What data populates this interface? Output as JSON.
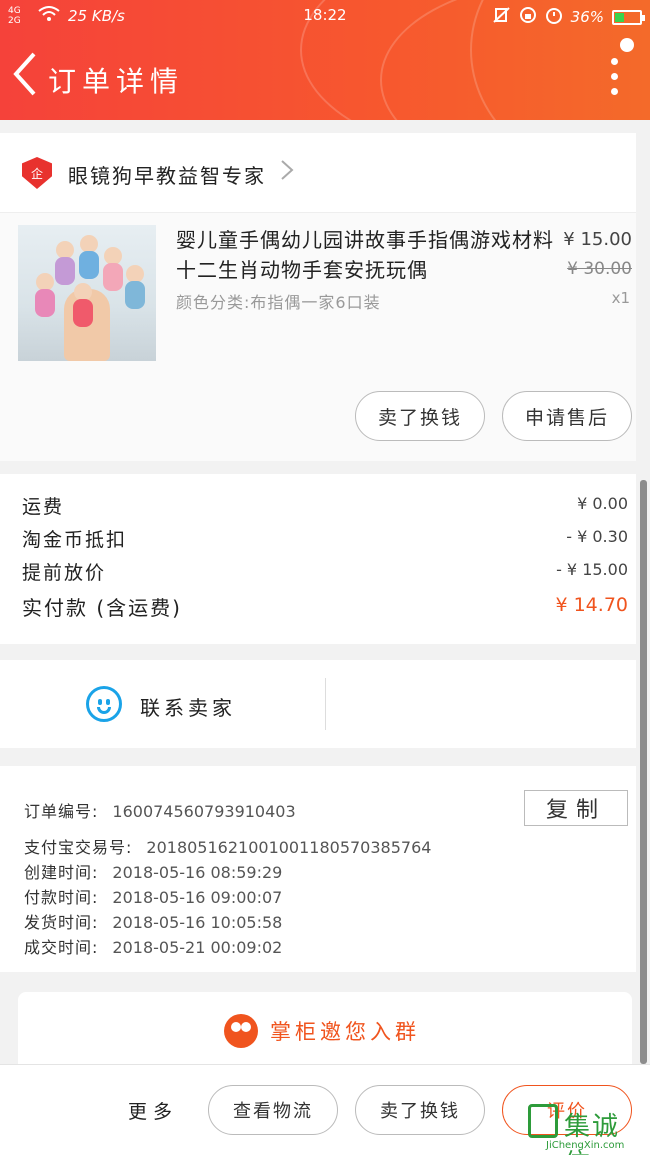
{
  "status_bar": {
    "network": "4G 2G",
    "speed": "25 KB/s",
    "time": "18:22",
    "battery": "36%"
  },
  "header": {
    "title": "订单详情"
  },
  "shop": {
    "name": "眼镜狗早教益智专家",
    "badge": "企"
  },
  "product": {
    "title": "婴儿童手偶幼儿园讲故事手指偶游戏材料十二生肖动物手套安抚玩偶",
    "sku": "颜色分类:布指偶一家6口装",
    "price": "¥ 15.00",
    "original_price": "¥ 30.00",
    "quantity": "x1",
    "buttons": [
      "卖了换钱",
      "申请售后"
    ]
  },
  "fees": [
    {
      "label": "运费",
      "value": "¥ 0.00"
    },
    {
      "label": "淘金币抵扣",
      "value": "- ¥ 0.30"
    },
    {
      "label": "提前放价",
      "value": "- ¥ 15.00"
    },
    {
      "label": "实付款 (含运费)",
      "value": "¥ 14.70"
    }
  ],
  "contact": {
    "label": "联系卖家"
  },
  "order_info": {
    "copy_label": "复制",
    "rows": [
      {
        "label": "订单编号:",
        "value": "160074560793910403"
      },
      {
        "label": "支付宝交易号:",
        "value": "2018051621001001180570385764"
      },
      {
        "label": "创建时间:",
        "value": "2018-05-16 08:59:29"
      },
      {
        "label": "付款时间:",
        "value": "2018-05-16 09:00:07"
      },
      {
        "label": "发货时间:",
        "value": "2018-05-16 10:05:58"
      },
      {
        "label": "成交时间:",
        "value": "2018-05-21 00:09:02"
      }
    ]
  },
  "group_invite": {
    "label": "掌柜邀您入群"
  },
  "bottom_bar": {
    "more": "更多",
    "logistics": "查看物流",
    "sell": "卖了换钱",
    "review": "评价"
  },
  "watermark": {
    "text": "集诚信",
    "url": "JiChengXin.com"
  },
  "colors": {
    "accent": "#f0541e",
    "header": "#f5423a",
    "contact_icon": "#1aa3e8"
  }
}
